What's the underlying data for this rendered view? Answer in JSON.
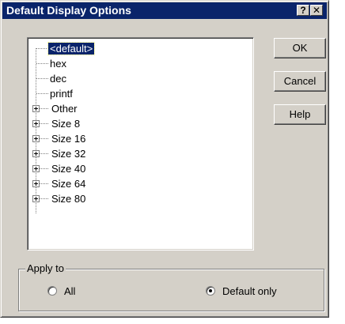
{
  "window": {
    "title": "Default Display Options",
    "help_label": "?",
    "close_label": "✕"
  },
  "tree": {
    "leaf_items": [
      {
        "label": "<default>",
        "selected": true
      },
      {
        "label": "hex",
        "selected": false
      },
      {
        "label": "dec",
        "selected": false
      },
      {
        "label": "printf",
        "selected": false
      }
    ],
    "branch_items": [
      {
        "label": "Other",
        "expandable": true
      },
      {
        "label": "Size 8",
        "expandable": true
      },
      {
        "label": "Size 16",
        "expandable": true
      },
      {
        "label": "Size 32",
        "expandable": true
      },
      {
        "label": "Size 40",
        "expandable": true
      },
      {
        "label": "Size 64",
        "expandable": true
      },
      {
        "label": "Size 80",
        "expandable": true
      }
    ]
  },
  "buttons": {
    "ok": "OK",
    "cancel": "Cancel",
    "help": "Help"
  },
  "apply_to": {
    "legend": "Apply to",
    "options": [
      {
        "label": "All",
        "checked": false
      },
      {
        "label": "Default only",
        "checked": true
      }
    ]
  },
  "colors": {
    "title_bar": "#0a246a",
    "face": "#d4d0c8",
    "selection": "#0a246a"
  }
}
